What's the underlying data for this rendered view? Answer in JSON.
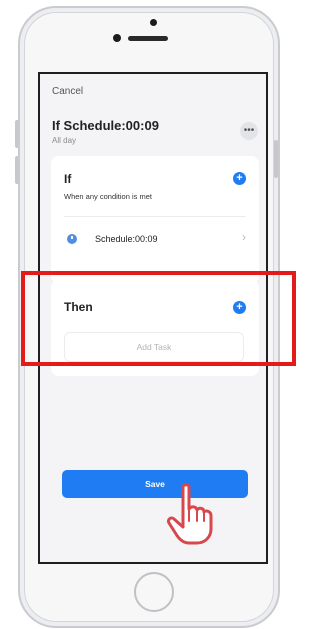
{
  "header": {
    "cancel_label": "Cancel",
    "title": "If Schedule:00:09",
    "subtitle": "All day",
    "more_label": "•••"
  },
  "if_section": {
    "title": "If",
    "description": "When any condition is met",
    "condition_label": "Schedule:00:09"
  },
  "then_section": {
    "title": "Then",
    "add_task_label": "Add Task"
  },
  "footer": {
    "save_label": "Save"
  },
  "colors": {
    "accent": "#1f7cf3",
    "highlight": "#e31b1b",
    "screen_bg": "#f4f4f6"
  },
  "icons": [
    "add-icon",
    "schedule-clock-icon",
    "chevron-right-icon",
    "more-icon",
    "hand-pointer-icon"
  ]
}
